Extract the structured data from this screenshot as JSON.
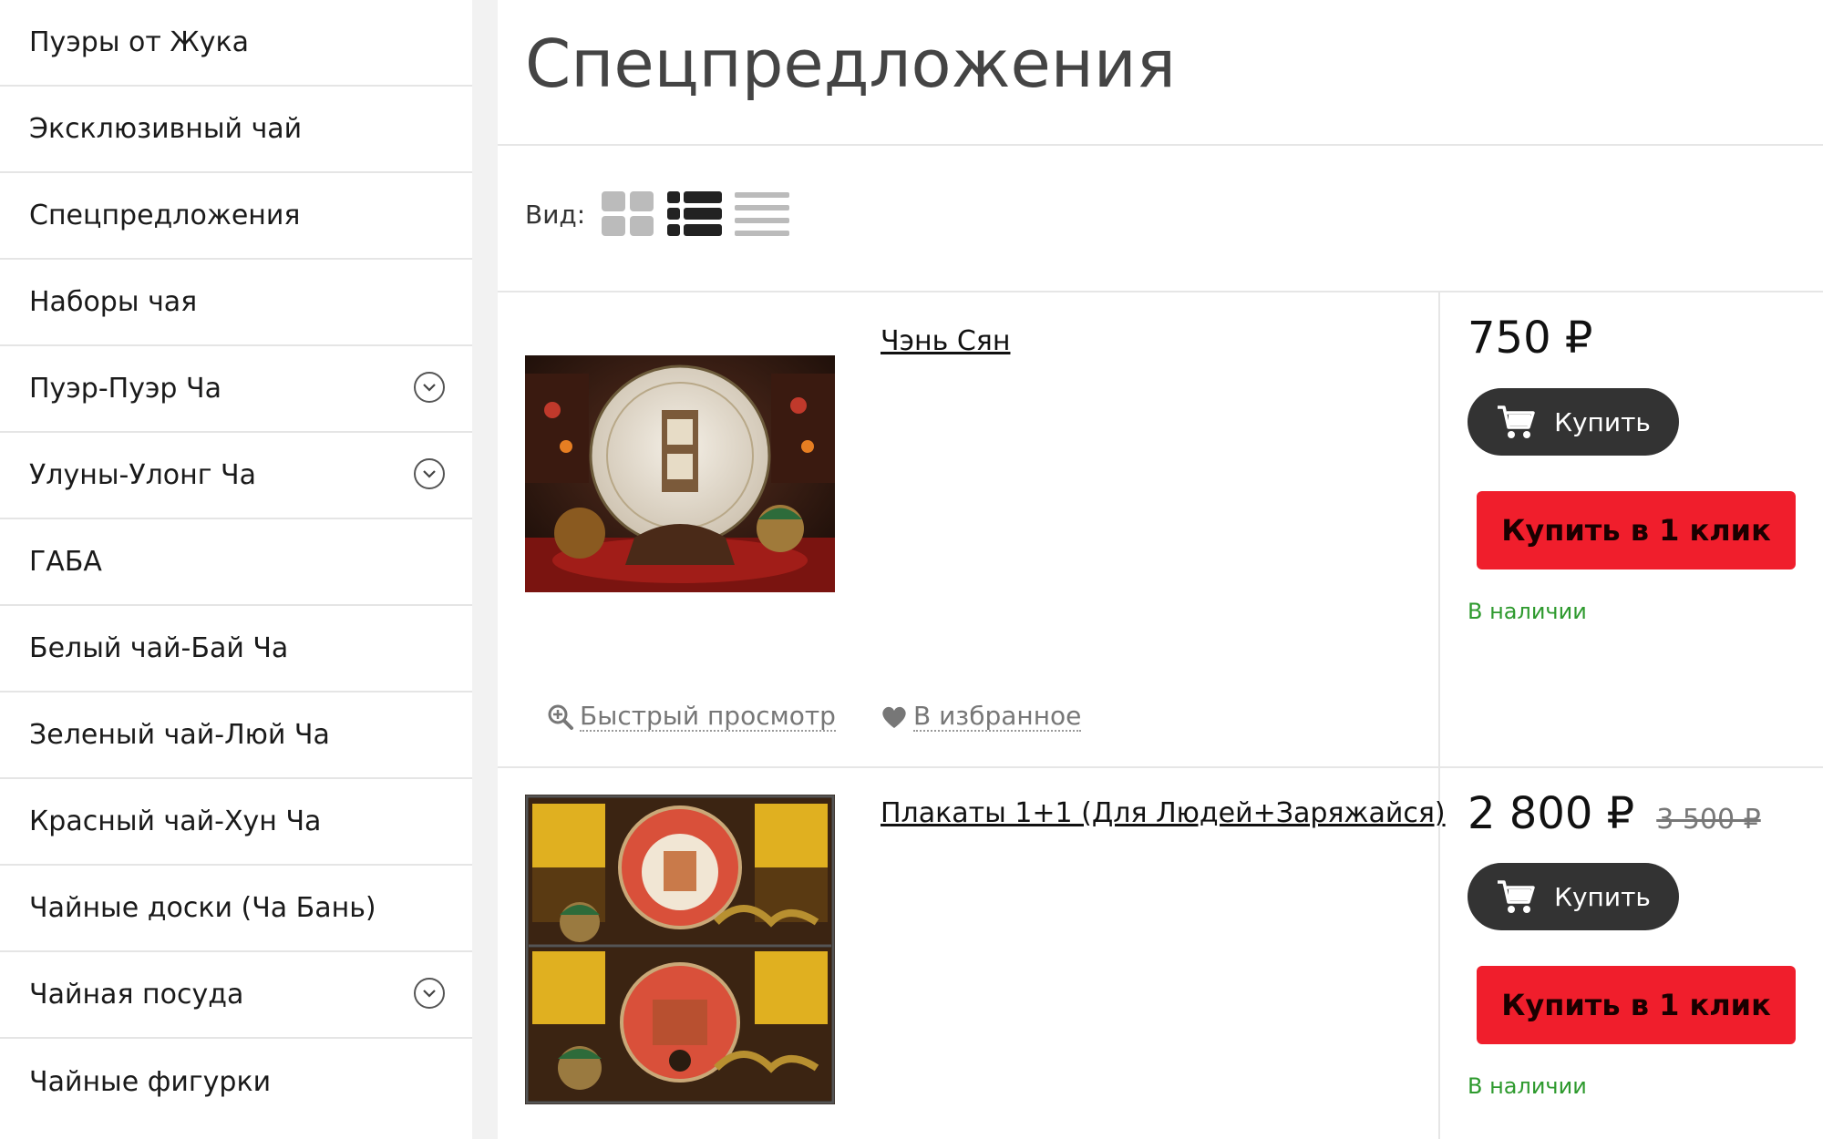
{
  "sidebar": {
    "items": [
      {
        "label": "Пуэры от Жука",
        "expandable": false
      },
      {
        "label": "Эксклюзивный чай",
        "expandable": false
      },
      {
        "label": "Спецпредложения",
        "expandable": false
      },
      {
        "label": "Наборы чая",
        "expandable": false
      },
      {
        "label": "Пуэр-Пуэр Ча",
        "expandable": true
      },
      {
        "label": "Улуны-Улонг Ча",
        "expandable": true
      },
      {
        "label": "ГАБА",
        "expandable": false
      },
      {
        "label": "Белый чай-Бай Ча",
        "expandable": false
      },
      {
        "label": "Зеленый чай-Люй Ча",
        "expandable": false
      },
      {
        "label": "Красный чай-Хун Ча",
        "expandable": false
      },
      {
        "label": "Чайные доски (Ча Бань)",
        "expandable": false
      },
      {
        "label": "Чайная посуда",
        "expandable": true
      },
      {
        "label": "Чайные фигурки",
        "expandable": false
      }
    ]
  },
  "main": {
    "title": "Спецпредложения",
    "view": {
      "label": "Вид:",
      "options": [
        "grid",
        "list",
        "compact"
      ],
      "active": "list"
    }
  },
  "products": [
    {
      "name": "Чэнь Сян",
      "price": "750 ₽",
      "old_price": null,
      "buy_label": "Купить",
      "oneclick_label": "Купить в 1 клик",
      "stock": "В наличии",
      "quick_view": "Быстрый просмотр",
      "favorite": "В избранное",
      "image_icon": "tea-cake-product-photo"
    },
    {
      "name": "Плакаты 1+1 (Для Людей+Заряжайся)",
      "price": "2 800 ₽",
      "old_price": "3 500 ₽",
      "buy_label": "Купить",
      "oneclick_label": "Купить в 1 клик",
      "stock": "В наличии",
      "image_icon": "poster-tea-cakes-product-photo"
    }
  ],
  "colors": {
    "accent_red": "#f01e2c",
    "button_dark": "#333333",
    "in_stock_green": "#2e9a2e"
  }
}
